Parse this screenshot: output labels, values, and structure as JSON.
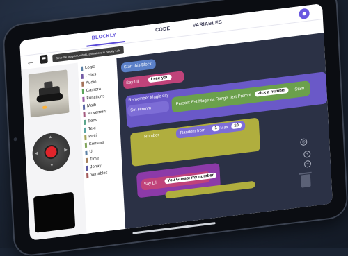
{
  "tabs": {
    "blockly": "BLOCKLY",
    "code": "CODE",
    "variables": "VARIABLES"
  },
  "tooltip": "Save the program, robots, animations in Blockly Lab",
  "categories": [
    {
      "label": "Logic",
      "color": "#5b80a5"
    },
    {
      "label": "Listes",
      "color": "#745ba5"
    },
    {
      "label": "Audio",
      "color": "#a5745b"
    },
    {
      "label": "Camera",
      "color": "#5ba55b"
    },
    {
      "label": "Functions",
      "color": "#995ba5"
    },
    {
      "label": "Math",
      "color": "#5b67a5"
    },
    {
      "label": "Movement",
      "color": "#a55b80"
    },
    {
      "label": "Sens",
      "color": "#5ba58c"
    },
    {
      "label": "Text",
      "color": "#5ba5a5"
    },
    {
      "label": "Petri",
      "color": "#a5a55b"
    },
    {
      "label": "Sensors",
      "color": "#80a55b"
    },
    {
      "label": "UI",
      "color": "#5b80a5"
    },
    {
      "label": "Time",
      "color": "#a5805b"
    },
    {
      "label": "Jonay",
      "color": "#5b5ba5"
    },
    {
      "label": "Variables",
      "color": "#a55b5b"
    }
  ],
  "blocks": {
    "start": "Start this Block",
    "say1": "Say Lili",
    "say1_value": "I see you",
    "remember": "Remember Magic say",
    "set": "Set Hmmm",
    "prompt": "Person: Est Magenta Range Text Prompt",
    "prompt_value": "Pick a number",
    "prompt_tail": "Stam",
    "repeat": "Number",
    "random": "Random from",
    "from": "1",
    "to_label": "Max",
    "to": "10",
    "say2": "Say Lili",
    "say2_value": "You Guess: my number"
  },
  "colors": {
    "accent": "#5b4bd8",
    "workspace": "#2b3145",
    "joystick": "#e0242b"
  }
}
